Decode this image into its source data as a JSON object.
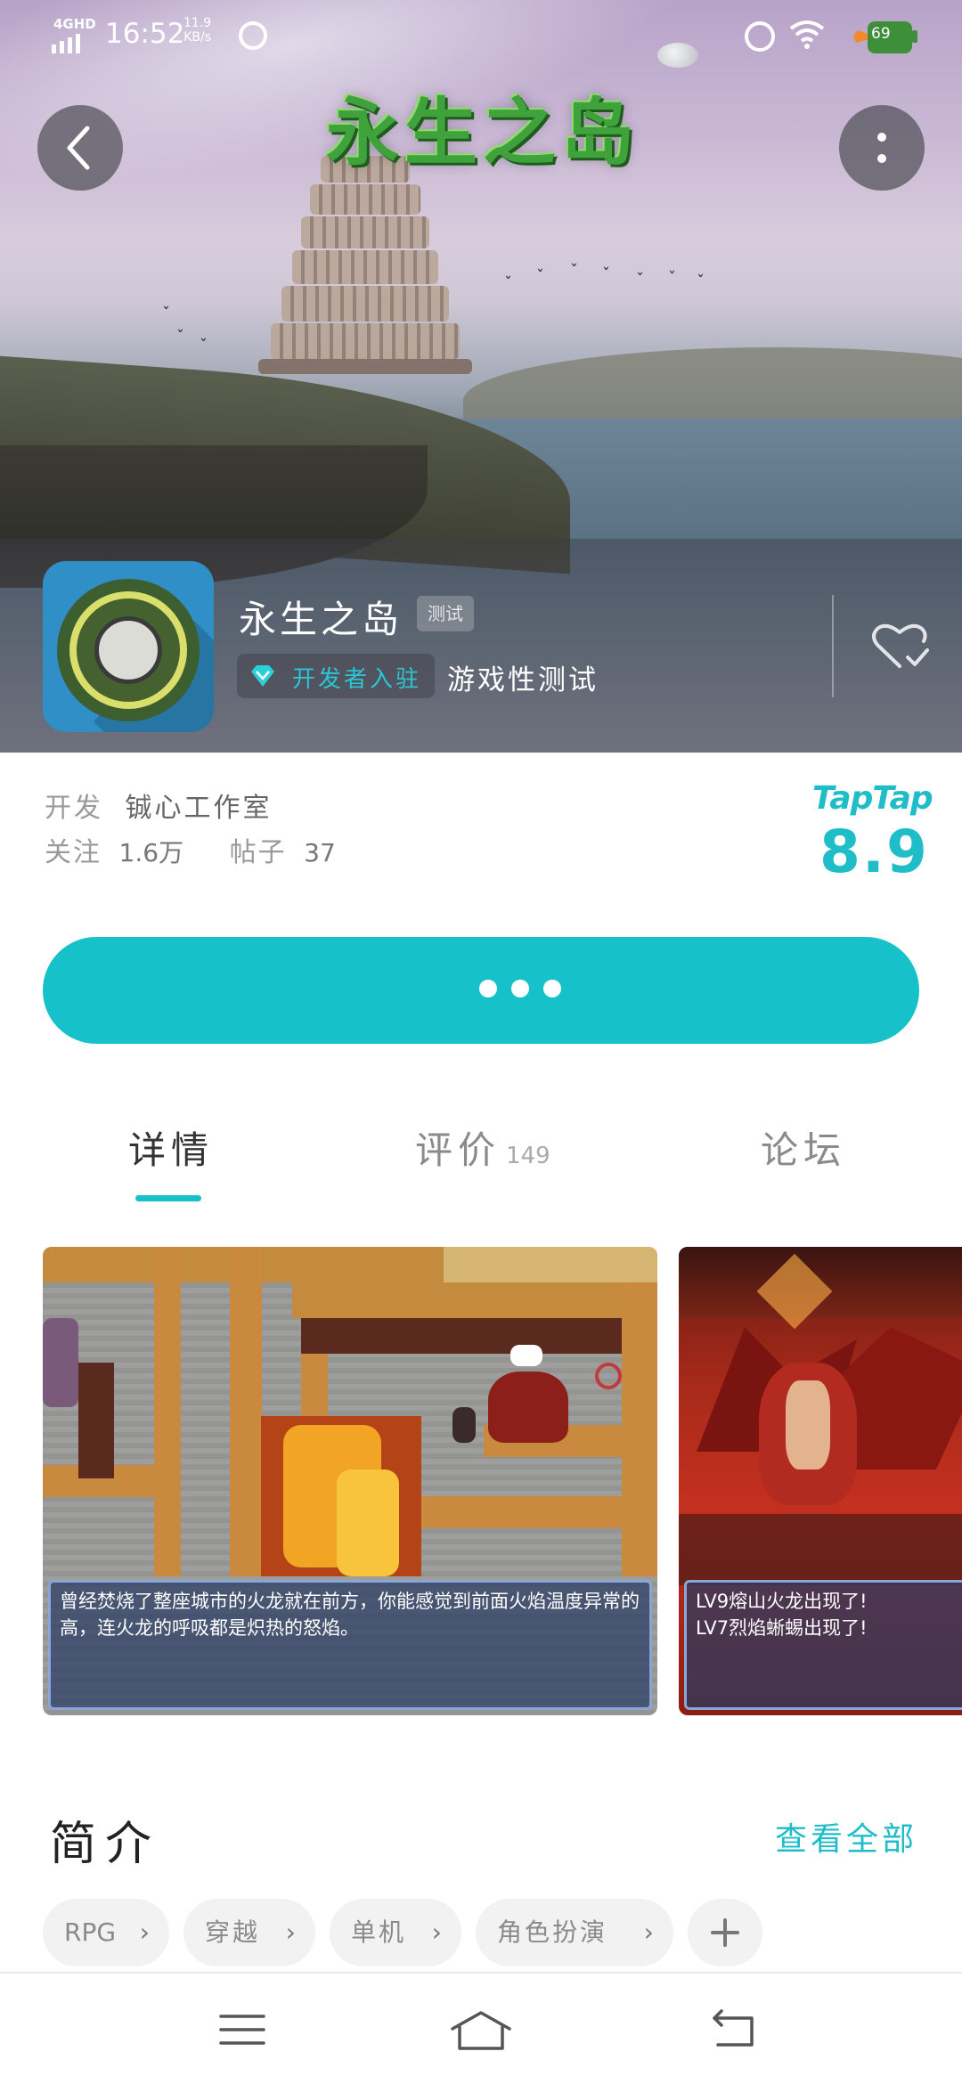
{
  "status_bar": {
    "network": "4GHD",
    "time": "16:52",
    "speed_value": "11.9",
    "speed_unit": "KB/s",
    "battery_level": "69"
  },
  "hero": {
    "logo_title": "永生之岛"
  },
  "game": {
    "title": "永生之岛",
    "test_badge": "测试",
    "developer_badge": "开发者入驻",
    "test_type": "游戏性测试"
  },
  "meta": {
    "developer_label": "开发",
    "developer_name": "铖心工作室",
    "followers_label": "关注",
    "followers_value": "1.6万",
    "posts_label": "帖子",
    "posts_value": "37",
    "platform_logo": "TapTap",
    "rating": "8.9"
  },
  "tabs": {
    "details": "详情",
    "reviews": "评价",
    "reviews_count": "149",
    "forum": "论坛"
  },
  "screenshots": [
    {
      "dialog": "曾经焚烧了整座城市的火龙就在前方，你能感觉到前面火焰温度异常的高，连火龙的呼吸都是炽热的怒焰。"
    },
    {
      "dialog_line1": "LV9熔山火龙出现了!",
      "dialog_line2": "LV7烈焰蜥蜴出现了!"
    }
  ],
  "intro": {
    "title": "简介",
    "view_all": "查看全部",
    "tags": [
      "RPG",
      "穿越",
      "单机",
      "角色扮演"
    ],
    "tag_chevron": "›"
  },
  "colors": {
    "accent": "#17c1c9",
    "logo_green": "#3fa23c"
  },
  "icons": {
    "back": "chevron-left-icon",
    "more": "more-vertical-icon",
    "follow": "heart-check-icon",
    "developer": "diamond-icon",
    "add": "plus-icon",
    "nav_menu": "menu-icon",
    "nav_home": "home-icon",
    "nav_back": "return-icon"
  }
}
